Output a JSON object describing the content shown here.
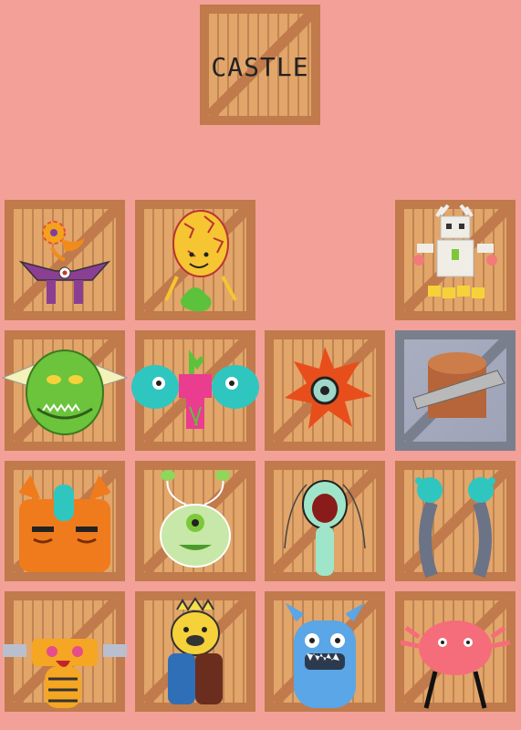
{
  "title_crate": {
    "label": "CASTLE"
  },
  "grid": {
    "rows": [
      [
        {
          "name": "orange-bird-monster",
          "empty": false
        },
        {
          "name": "yellow-leaf-monster",
          "empty": false
        },
        {
          "name": "empty-slot",
          "empty": true
        },
        {
          "name": "white-bone-robot-monster",
          "empty": false
        }
      ],
      [
        {
          "name": "green-winged-monster",
          "empty": false
        },
        {
          "name": "teal-eyes-monster",
          "empty": false
        },
        {
          "name": "red-flower-eye-monster",
          "empty": false
        },
        {
          "name": "locked-egg-slot",
          "empty": false
        }
      ],
      [
        {
          "name": "orange-two-faced-monster",
          "empty": false
        },
        {
          "name": "green-antenna-monster",
          "empty": false
        },
        {
          "name": "screaming-worm-monster",
          "empty": false
        },
        {
          "name": "grey-pillar-hands-monster",
          "empty": false
        }
      ],
      [
        {
          "name": "yellow-bee-monster",
          "empty": false
        },
        {
          "name": "crowned-bear-monster",
          "empty": false
        },
        {
          "name": "blue-furry-monster",
          "empty": false
        },
        {
          "name": "pink-crab-monster",
          "empty": false
        }
      ]
    ]
  }
}
